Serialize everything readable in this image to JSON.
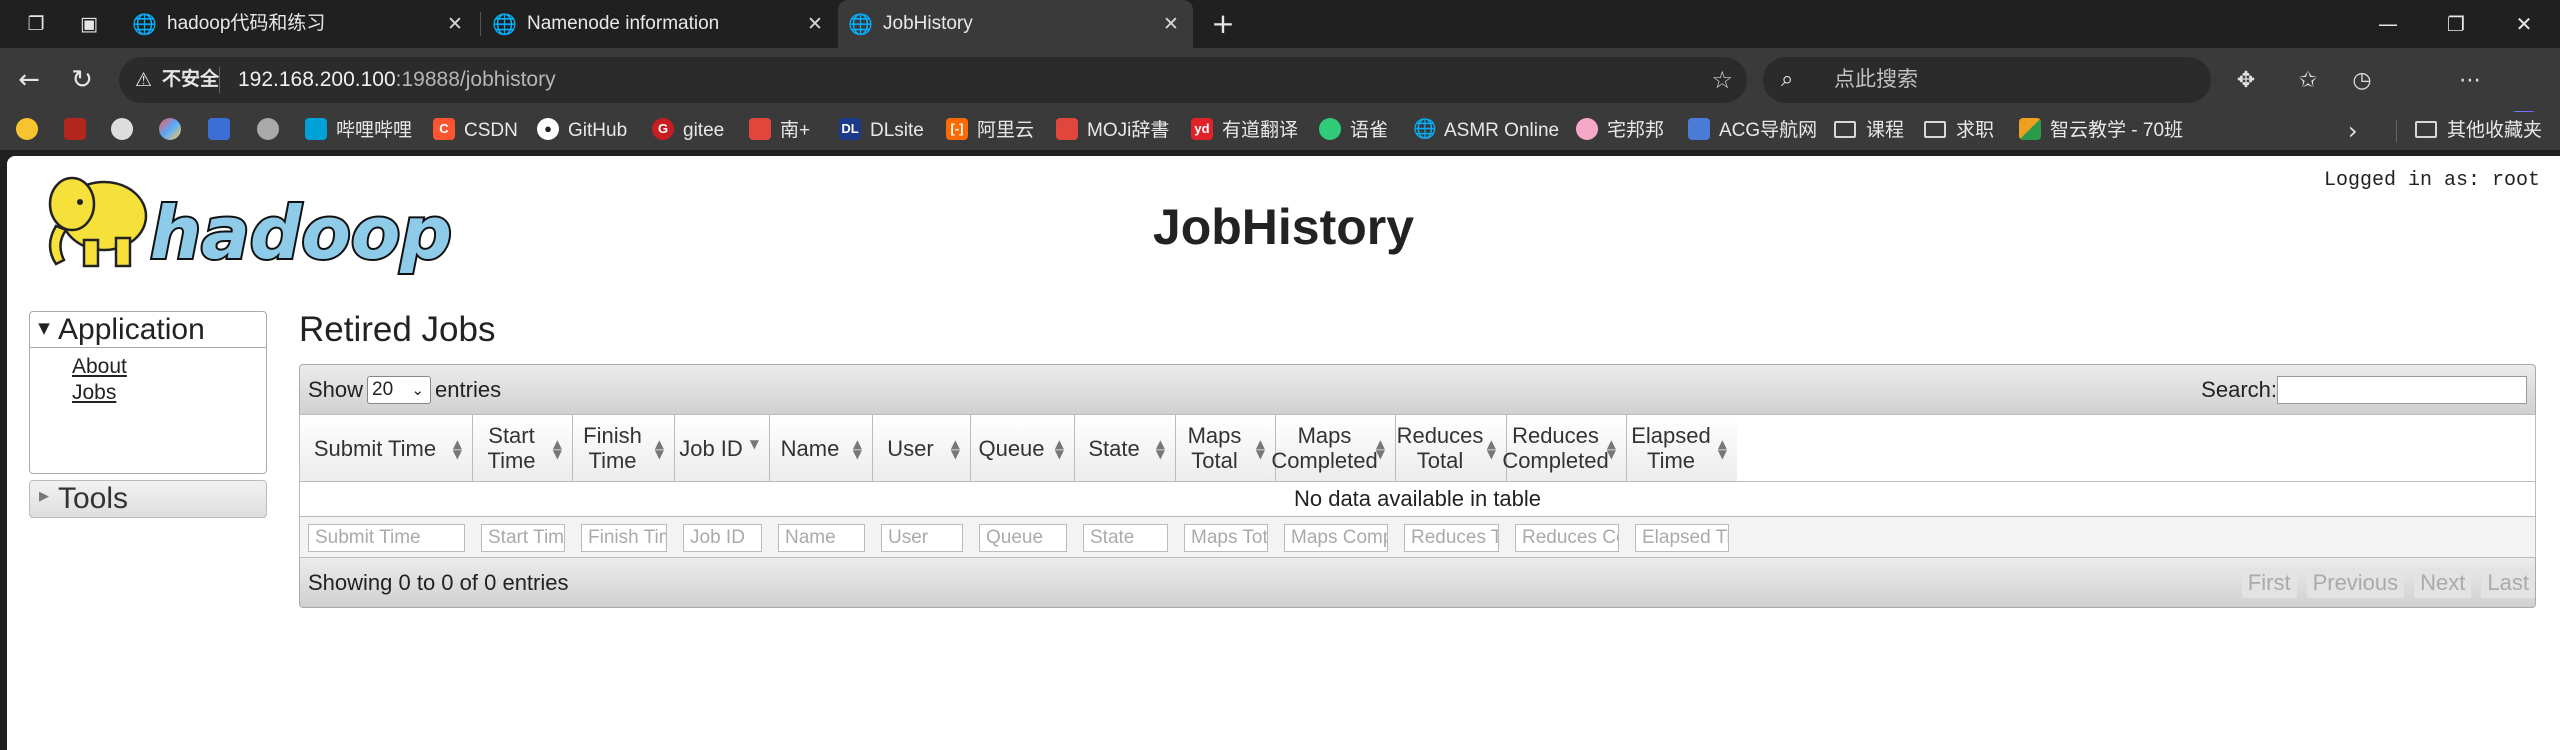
{
  "browser": {
    "tabs": [
      {
        "title": "hadoop代码和练习",
        "active": false
      },
      {
        "title": "Namenode information",
        "active": false
      },
      {
        "title": "JobHistory",
        "active": true
      }
    ],
    "new_tab": "+",
    "address": {
      "security_label": "不安全",
      "host": "192.168.200.100",
      "path": ":19888/jobhistory"
    },
    "search_placeholder": "点此搜索",
    "bookmarks": [
      {
        "label": "哔哩哔哩",
        "icon": "bilibili-icon",
        "color": "#00a1d6"
      },
      {
        "label": "CSDN",
        "icon": "csdn-icon",
        "color": "#fc5531"
      },
      {
        "label": "GitHub",
        "icon": "github-icon",
        "color": "#ffffff"
      },
      {
        "label": "gitee",
        "icon": "gitee-icon",
        "color": "#c71d23"
      },
      {
        "label": "南+",
        "icon": "south-plus-icon",
        "color": "#e0463c"
      },
      {
        "label": "DLsite",
        "icon": "dlsite-icon",
        "color": "#1b3a8c"
      },
      {
        "label": "阿里云",
        "icon": "aliyun-icon",
        "color": "#ff6a00"
      },
      {
        "label": "MOJi辞書",
        "icon": "moji-icon",
        "color": "#e0463c"
      },
      {
        "label": "有道翻译",
        "icon": "youdao-icon",
        "color": "#e0232a"
      },
      {
        "label": "语雀",
        "icon": "yuque-icon",
        "color": "#31cc79"
      },
      {
        "label": "ASMR Online",
        "icon": "globe-icon",
        "color": "#dddddd"
      },
      {
        "label": "宅邦邦",
        "icon": "zhaibangbang-icon",
        "color": "#f7a8c8"
      },
      {
        "label": "ACG导航网",
        "icon": "acg-icon",
        "color": "#4a7bd6"
      },
      {
        "label": "课程",
        "icon": "folder-icon",
        "color": "#dddddd"
      },
      {
        "label": "求职",
        "icon": "folder-icon",
        "color": "#dddddd"
      },
      {
        "label": "智云教学 - 70班",
        "icon": "zhiyun-icon",
        "color": "#f0a020"
      }
    ],
    "other_bookmarks": "其他收藏夹"
  },
  "page": {
    "title": "JobHistory",
    "logged_in": "Logged in as: root",
    "sidebar": {
      "application_label": "Application",
      "links": [
        "About",
        "Jobs"
      ],
      "tools_label": "Tools"
    },
    "section_title": "Retired Jobs",
    "table": {
      "show_label": "Show",
      "entries_value": "20",
      "entries_label": "entries",
      "search_label": "Search:",
      "columns": [
        "Submit Time",
        "Start Time",
        "Finish Time",
        "Job ID",
        "Name",
        "User",
        "Queue",
        "State",
        "Maps Total",
        "Maps Completed",
        "Reduces Total",
        "Reduces Completed",
        "Elapsed Time"
      ],
      "sorted_column": "Job ID",
      "empty_message": "No data available in table",
      "info": "Showing 0 to 0 of 0 entries",
      "pagination": [
        "First",
        "Previous",
        "Next",
        "Last"
      ]
    }
  }
}
